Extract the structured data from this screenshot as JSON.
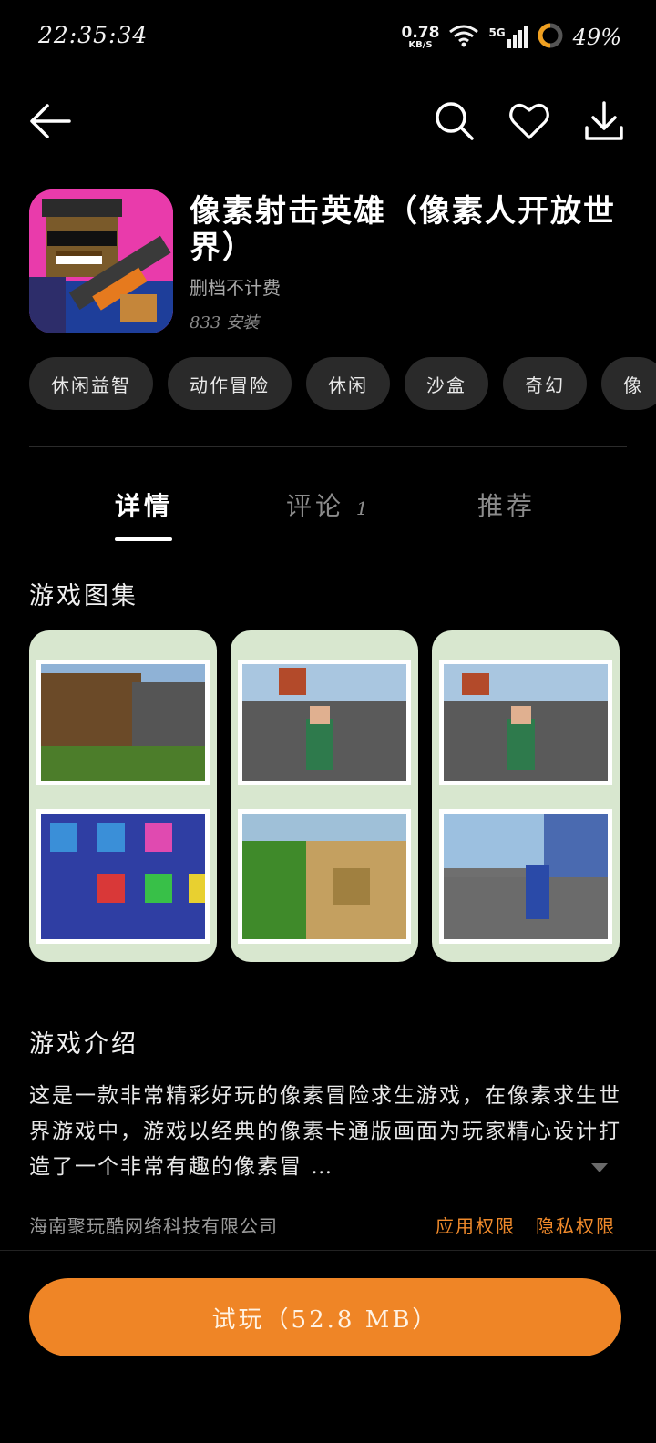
{
  "status_bar": {
    "time": "22:35:34",
    "net_speed_value": "0.78",
    "net_speed_unit": "KB/S",
    "network_type": "5G",
    "battery_percent": "49%"
  },
  "nav": {
    "icons": [
      "back-arrow-icon",
      "search-icon",
      "heart-icon",
      "download-icon"
    ]
  },
  "app": {
    "title": "像素射击英雄（像素人开放世界）",
    "subtitle": "删档不计费",
    "installs": "833 安装"
  },
  "tags": [
    "休闲益智",
    "动作冒险",
    "休闲",
    "沙盒",
    "奇幻",
    "像"
  ],
  "tabs": {
    "details": "详情",
    "comments": "评论",
    "comments_count": "1",
    "recommend": "推荐"
  },
  "gallery": {
    "title": "游戏图集"
  },
  "intro": {
    "title": "游戏介绍",
    "text": "这是一款非常精彩好玩的像素冒险求生游戏，在像素求生世界游戏中，游戏以经典的像素卡通版画面为玩家精心设计打造了一个非常有趣的像素冒 …"
  },
  "footer": {
    "company": "海南聚玩酷网络科技有限公司",
    "app_permissions": "应用权限",
    "privacy_permissions": "隐私权限",
    "play_button": "试玩（52.8 MB）"
  },
  "colors": {
    "accent": "#ef8526",
    "link": "#f08a2b",
    "background": "#000000"
  }
}
